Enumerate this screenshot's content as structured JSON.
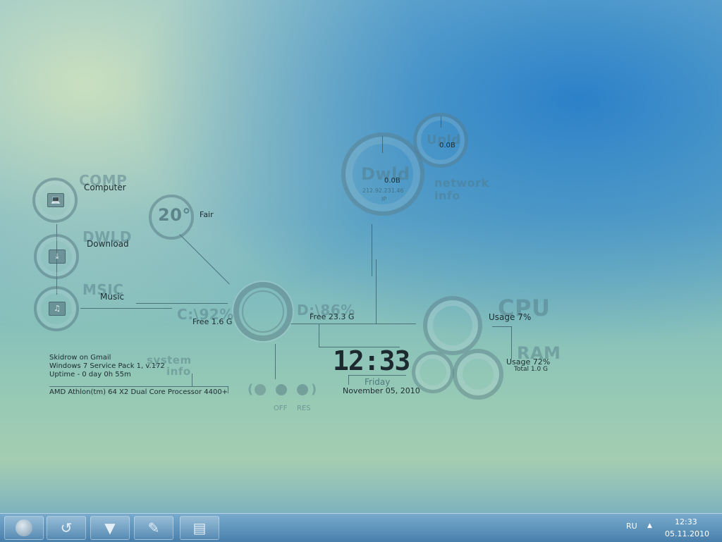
{
  "launcher": {
    "items": [
      {
        "ghost": "COMP",
        "label": "Computer",
        "icon": "laptop-icon"
      },
      {
        "ghost": "DWLD",
        "label": "Download",
        "icon": "download-folder-icon"
      },
      {
        "ghost": "MSIC",
        "label": "Music",
        "icon": "music-folder-icon"
      }
    ]
  },
  "weather": {
    "temp": "20°",
    "condition": "Fair"
  },
  "drives": {
    "c": {
      "ghost": "C:\\92%",
      "free": "Free 1.6 G",
      "used_fraction": 0.92
    },
    "d": {
      "ghost": "D:\\86%",
      "free": "Free 23.3 G",
      "used_fraction": 0.86
    }
  },
  "system": {
    "ghost_title": "system",
    "ghost_sub": "info",
    "lines": [
      "Skidrow on Gmail",
      "Windows 7 Service Pack 1, v.172",
      "Uptime - 0 day 0h 55m"
    ],
    "cpu_name": "AMD Athlon(tm) 64 X2 Dual Core Processor 4400+"
  },
  "power": {
    "off_label": "OFF",
    "res_label": "RES"
  },
  "clock": {
    "time": "12:33",
    "day": "Friday",
    "date": "November 05, 2010"
  },
  "network": {
    "dwld_ghost": "Dwld",
    "dwld_value": "0.0B",
    "ip": "212.92.231.46",
    "ip_label": "IP",
    "upld_ghost": "Upld",
    "upld_value": "0.0B",
    "title_line1": "network",
    "title_line2": "info"
  },
  "cpu": {
    "ghost": "CPU",
    "usage": "Usage  7%",
    "usage_fraction": 0.07
  },
  "ram": {
    "ghost": "RAM",
    "usage": "Usage   72%",
    "total": "Total 1.0 G",
    "usage_fraction": 0.72
  },
  "taskbar": {
    "buttons": [
      "start-orb-icon",
      "back-arrow-icon",
      "fox-icon",
      "feather-icon",
      "folder-icon"
    ],
    "language": "RU",
    "time": "12:33",
    "date": "05.11.2010"
  },
  "colors": {
    "accent": "#3f7b8a",
    "ghost": "#5a8590",
    "text": "#1d2b30"
  }
}
